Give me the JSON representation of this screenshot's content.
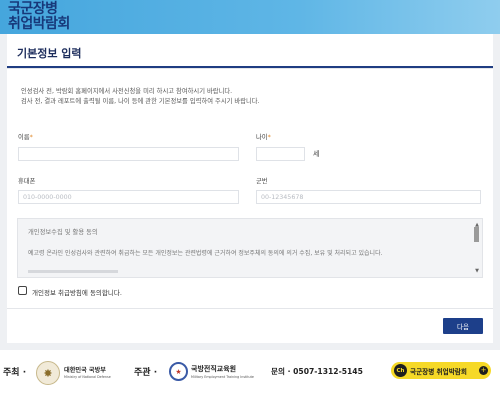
{
  "brand": {
    "line1": "국군장병",
    "line2": "취업박람회"
  },
  "form": {
    "title": "기본정보 입력",
    "intro": [
      "인성검사 전, 박람회 홈페이지에서 사전신청을 미리 하시고 참여하시기 바랍니다.",
      "검사 전, 결과 레포트에 출력될 이름, 나이 등에 관한 기본정보를 입력하여 주시기 바랍니다."
    ],
    "name": {
      "label": "이름",
      "required_mark": "*",
      "value": ""
    },
    "age": {
      "label": "나이",
      "required_mark": "*",
      "value": "",
      "unit": "세"
    },
    "phone": {
      "label": "휴대폰",
      "placeholder": "010-0000-0000",
      "value": ""
    },
    "service_number": {
      "label": "군번",
      "placeholder": "00-12345678",
      "value": ""
    },
    "terms": {
      "title": "개인정보수집 및 활용 동의",
      "body": "예고령 온라인 인성검사와 관련하여 취급하는 모든 개인정보는 관련법령에 근거하여 정보주체의 동의에 의거 수집, 보유 및 처리되고 있습니다."
    },
    "consent_label": "개인정보 취급방침에 동의합니다.",
    "consent_checked": false,
    "next_label": "다음"
  },
  "footer": {
    "host_label": "주최 ·",
    "host_org": "대한민국 국방부",
    "host_org_en": "Ministry of National Defense",
    "organizer_label": "주관 ·",
    "organizer_org": "국방전직교육원",
    "organizer_org_en": "Military Employment Training Institute",
    "contact": "문의 · 0507-1312-5145",
    "cta_badge": "Ch",
    "cta_label": "국군장병 취업박람회",
    "cta_plus": "+"
  },
  "colors": {
    "header_band": "#45a6dd",
    "brand_text": "#17387a",
    "accent_navy": "#1d3f8a",
    "required_mark": "#e08a2c",
    "cta_yellow": "#f6d927"
  }
}
